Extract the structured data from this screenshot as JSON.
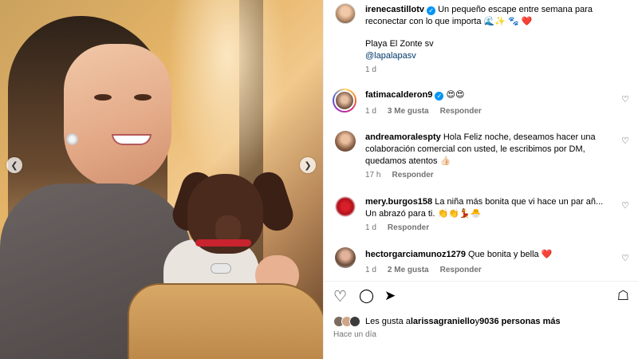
{
  "post": {
    "author": "irenecastillotv",
    "caption": "Un pequeño escape entre semana para reconectar con lo que importa 🌊✨ 🐾 ❤️",
    "location_line": "Playa El Zonte sv",
    "mention": "@lapalapasv",
    "time": "1 d"
  },
  "comments": [
    {
      "user": "fatimacalderon9",
      "verified": true,
      "text": "😍😍",
      "time": "1 d",
      "likes": "3 Me gusta",
      "reply": "Responder"
    },
    {
      "user": "andreamoralespty",
      "verified": false,
      "text": "Hola Feliz noche, deseamos hacer una colaboración comercial con usted, le escribimos por DM, quedamos atentos 👍🏻",
      "time": "17 h",
      "likes": "",
      "reply": "Responder"
    },
    {
      "user": "mery.burgos158",
      "verified": false,
      "text": "La niña más bonita que vi hace un par añ... Un abrazó para ti. 👏👏💃🐣",
      "time": "1 d",
      "likes": "",
      "reply": "Responder"
    },
    {
      "user": "hectorgarciamunoz1279",
      "verified": false,
      "text": "Que bonita y bella ❤️",
      "time": "1 d",
      "likes": "2 Me gusta",
      "reply": "Responder"
    }
  ],
  "footer": {
    "likes_prefix": "Les gusta a ",
    "likes_user": "larissagraniello",
    "likes_mid": " y ",
    "likes_count": "9036 personas más",
    "posted": "Hace un día"
  },
  "icons": {
    "prev": "chevron-left",
    "next": "chevron-right",
    "like": "heart",
    "comment": "speech-bubble",
    "share": "paper-plane",
    "save": "bookmark"
  }
}
